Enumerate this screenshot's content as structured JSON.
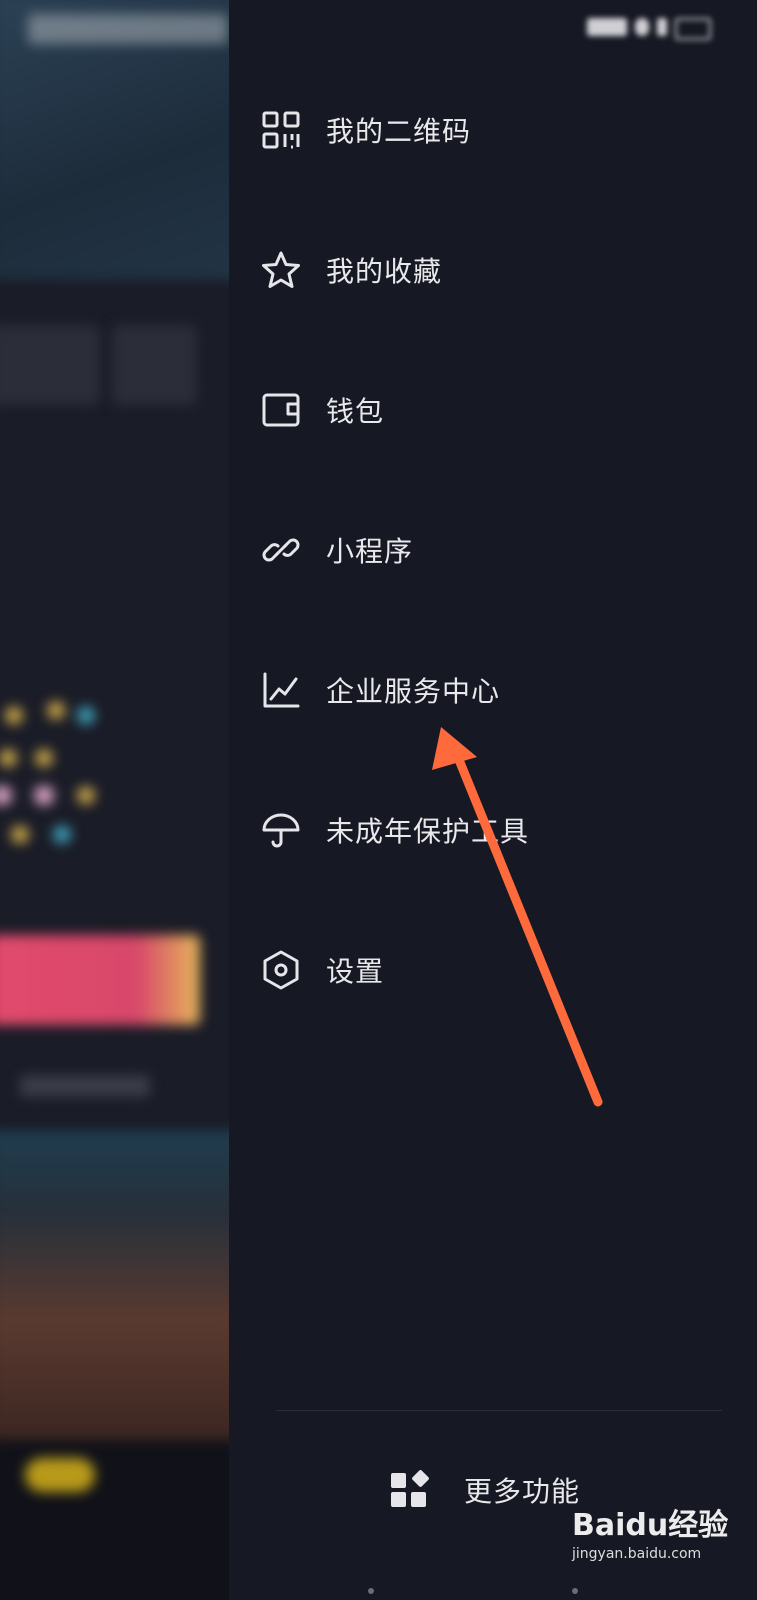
{
  "drawer": {
    "menu_items": [
      {
        "label": "我的二维码",
        "icon": "qr-code-icon"
      },
      {
        "label": "我的收藏",
        "icon": "star-icon"
      },
      {
        "label": "钱包",
        "icon": "wallet-icon"
      },
      {
        "label": "小程序",
        "icon": "link-icon"
      },
      {
        "label": "企业服务中心",
        "icon": "line-chart-icon"
      },
      {
        "label": "未成年保护工具",
        "icon": "umbrella-icon"
      },
      {
        "label": "设置",
        "icon": "hexagon-settings-icon"
      }
    ],
    "more_label": "更多功能",
    "more_icon": "grid-apps-icon"
  },
  "annotation": {
    "color": "#ff6a3d"
  },
  "watermark": {
    "brand": "Baidu经验",
    "url": "jingyan.baidu.com"
  }
}
